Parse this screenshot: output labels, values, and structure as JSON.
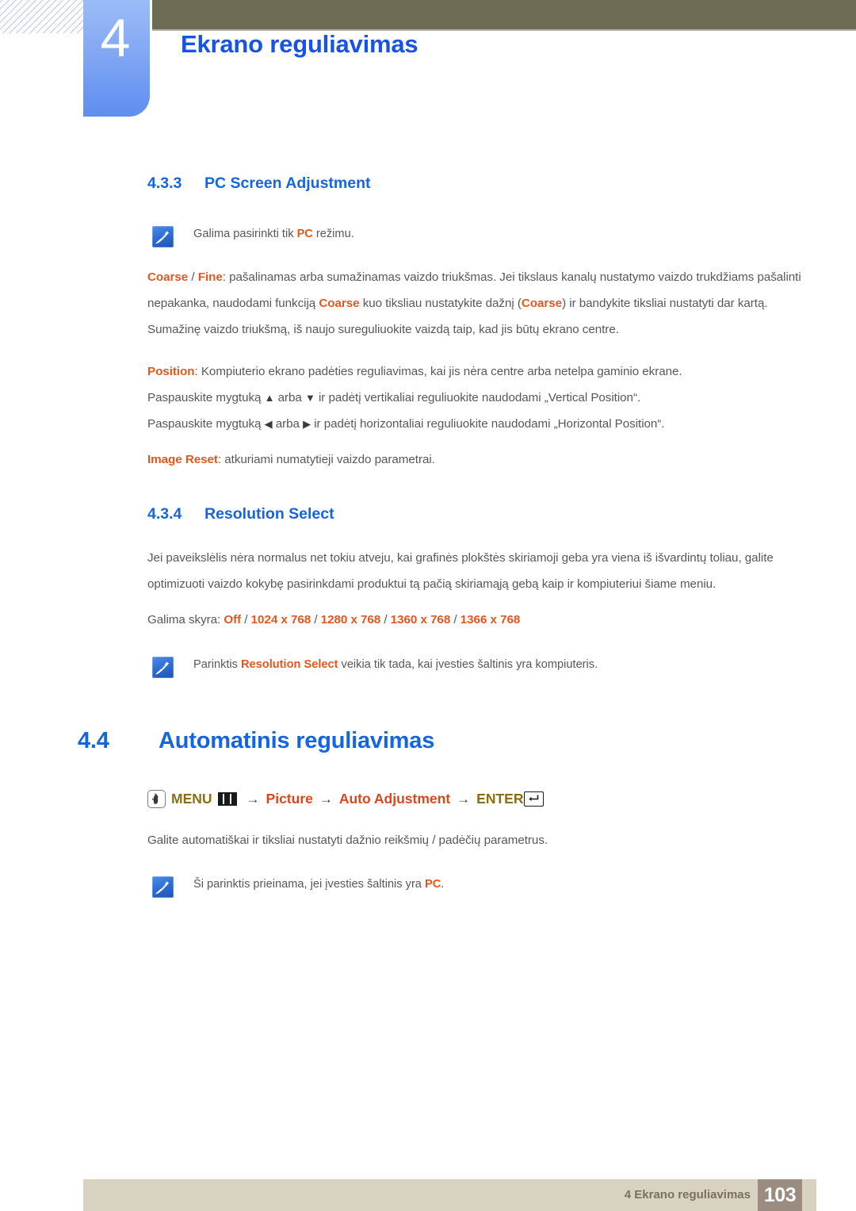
{
  "header": {
    "chapter_number": "4",
    "chapter_title": "Ekrano reguliavimas"
  },
  "sections": {
    "pc_screen_adjustment": {
      "number": "4.3.3",
      "title": "PC Screen Adjustment",
      "note1_prefix": "Galima pasirinkti tik ",
      "note1_highlight": "PC",
      "note1_suffix": " režimu.",
      "coarse_fine": {
        "term1": "Coarse",
        "sep": " / ",
        "term2": "Fine",
        "body": ": pašalinamas arba sumažinamas vaizdo triukšmas. Jei tikslaus kanalų nustatymo vaizdo trukdžiams pašalinti nepakanka, naudodami funkciją ",
        "inline1": "Coarse",
        "body2": " kuo tiksliau nustatykite dažnį (",
        "inline2": "Coarse",
        "body3": ") ir bandykite tiksliai nustatyti dar kartą. Sumažinę vaizdo triukšmą, iš naujo sureguliuokite vaizdą taip, kad jis būtų ekrano centre."
      },
      "position": {
        "term": "Position",
        "body": ": Kompiuterio ekrano padėties reguliavimas, kai jis nėra centre arba netelpa gaminio ekrane.",
        "line_vertical_pre": "Paspauskite mygtuką ",
        "line_vertical_up": "▲",
        "line_vertical_mid": " arba ",
        "line_vertical_down": "▼",
        "line_vertical_post": " ir padėtį vertikaliai reguliuokite naudodami „Vertical Position“.",
        "line_horizontal_pre": "Paspauskite mygtuką ",
        "line_horizontal_left": "◀",
        "line_horizontal_mid": " arba ",
        "line_horizontal_right": "▶",
        "line_horizontal_post": " ir padėtį horizontaliai reguliuokite naudodami „Horizontal Position“."
      },
      "image_reset": {
        "term": "Image Reset",
        "body": ": atkuriami numatytieji vaizdo parametrai."
      }
    },
    "resolution_select": {
      "number": "4.3.4",
      "title": "Resolution Select",
      "paragraph": "Jei paveikslėlis nėra normalus net tokiu atveju, kai grafinės plokštės skiriamoji geba yra viena iš išvardintų toliau, galite optimizuoti vaizdo kokybę pasirinkdami produktui tą pačią skiriamąją gebą kaip ir kompiuteriui šiame meniu.",
      "options_label": "Galima skyra: ",
      "options": [
        "Off",
        "1024 x 768",
        "1280 x 768",
        "1360 x 768",
        "1366 x 768"
      ],
      "options_separator": " / ",
      "note_prefix": "Parinktis ",
      "note_highlight": "Resolution Select",
      "note_suffix": " veikia tik tada, kai įvesties šaltinis yra kompiuteris."
    },
    "auto_adjustment": {
      "number": "4.4",
      "title": "Automatinis reguliavimas",
      "breadcrumb": {
        "menu_label": "MENU",
        "arrow": "→",
        "item1": "Picture",
        "item2": "Auto Adjustment",
        "enter_label": "ENTER"
      },
      "paragraph": "Galite automatiškai ir tiksliai nustatyti dažnio reikšmių / padėčių parametrus.",
      "note_prefix": "Ši parinktis prieinama, jei įvesties šaltinis yra ",
      "note_highlight": "PC",
      "note_suffix": "."
    }
  },
  "footer": {
    "label": "4 Ekrano reguliavimas",
    "page_number": "103"
  },
  "icons": {
    "note": "note-pen-icon",
    "hand": "hand-press-icon",
    "menu": "menu-bars-icon",
    "enter": "enter-return-icon"
  },
  "colors": {
    "heading_blue": "#1565e0",
    "highlight_orange": "#e2571e",
    "breadcrumb_gold": "#8a6d17",
    "breadcrumb_orange": "#d9481c",
    "olive_bar": "#6e6b55",
    "footer_bar": "#d8d3c0",
    "page_box": "#9a8c80"
  }
}
